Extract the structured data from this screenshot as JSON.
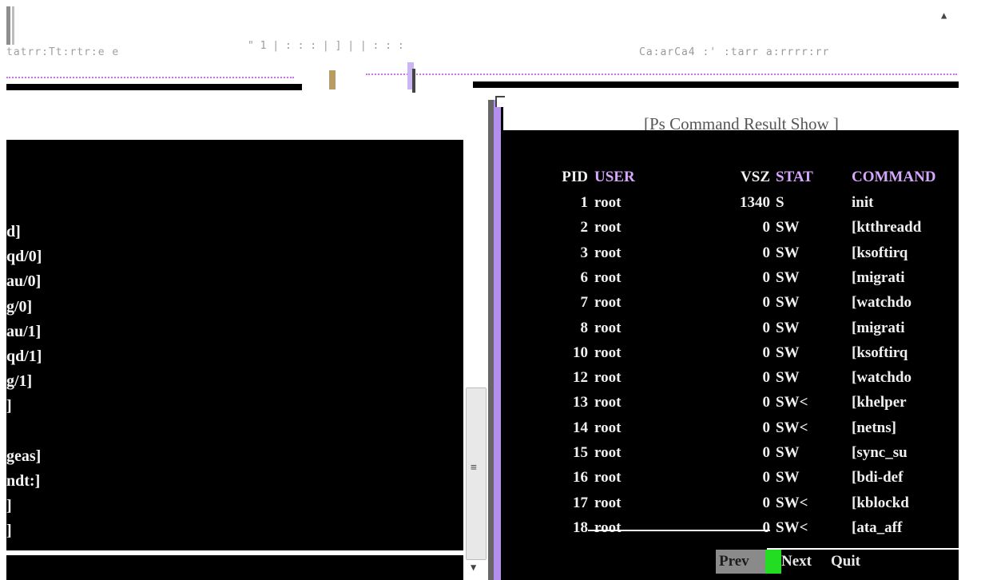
{
  "top": {
    "garbled_left": "tatrr:Tt:rtr:e  e",
    "garbled_mid": "\" 1       | : :  : | ] | | :   :  :",
    "garbled_right": "Ca:arCa4 :' :tarr a:rrrr:rr"
  },
  "left_panel": {
    "rows": [
      "d]",
      "qd/0]",
      "au/0]",
      "g/0]",
      "au/1]",
      "qd/1]",
      "g/1]",
      "]",
      "",
      "geas]",
      "ndt:]",
      "]",
      "]"
    ]
  },
  "right_panel": {
    "title": "[Ps Command Result Show ]",
    "headers": {
      "pid": "PID",
      "user": "USER",
      "vsz": "VSZ",
      "stat": "STAT",
      "command": "COMMAND"
    },
    "rows": [
      {
        "pid": "1",
        "user": "root",
        "vsz": "1340",
        "stat": "S",
        "command": "init"
      },
      {
        "pid": "2",
        "user": "root",
        "vsz": "0",
        "stat": "SW",
        "command": "[ktthreadd"
      },
      {
        "pid": "3",
        "user": "root",
        "vsz": "0",
        "stat": "SW",
        "command": "[ksoftirq"
      },
      {
        "pid": "6",
        "user": "root",
        "vsz": "0",
        "stat": "SW",
        "command": "[migrati"
      },
      {
        "pid": "7",
        "user": "root",
        "vsz": "0",
        "stat": "SW",
        "command": "[watchdo"
      },
      {
        "pid": "8",
        "user": "root",
        "vsz": "0",
        "stat": "SW",
        "command": "[migrati"
      },
      {
        "pid": "10",
        "user": "root",
        "vsz": "0",
        "stat": "SW",
        "command": "[ksoftirq"
      },
      {
        "pid": "12",
        "user": "root",
        "vsz": "0",
        "stat": "SW",
        "command": "[watchdo"
      },
      {
        "pid": "13",
        "user": "root",
        "vsz": "0",
        "stat": "SW<",
        "command": "[khelper"
      },
      {
        "pid": "14",
        "user": "root",
        "vsz": "0",
        "stat": "SW<",
        "command": "[netns]"
      },
      {
        "pid": "15",
        "user": "root",
        "vsz": "0",
        "stat": "SW",
        "command": "[sync_su"
      },
      {
        "pid": "16",
        "user": "root",
        "vsz": "0",
        "stat": "SW",
        "command": "[bdi-def"
      },
      {
        "pid": "17",
        "user": "root",
        "vsz": "0",
        "stat": "SW<",
        "command": "[kblockd"
      },
      {
        "pid": "18",
        "user": "root",
        "vsz": "0",
        "stat": "SW<",
        "command": "[ata_aff"
      }
    ],
    "buttons": {
      "prev": "Prev",
      "next": "Next",
      "quit": "Quit"
    }
  },
  "scrollbar": {
    "up": "▲",
    "down": "▼",
    "grip": "≡"
  },
  "colors": {
    "header": "#d7a7ff",
    "accent_violet": "#b58ff0",
    "next_marker": "#22dd22"
  }
}
